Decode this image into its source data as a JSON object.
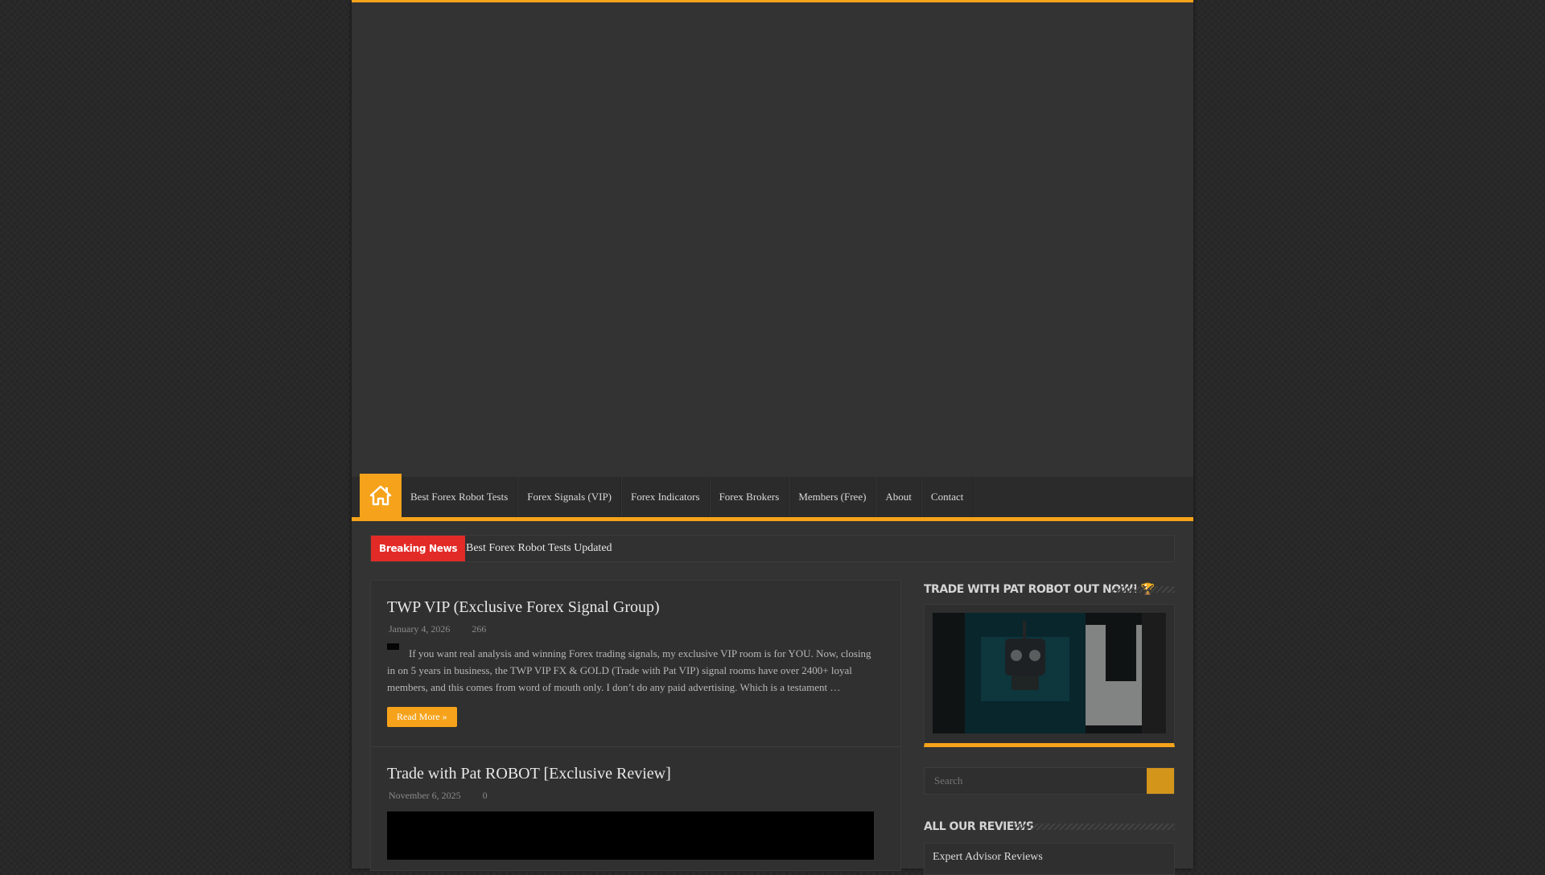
{
  "nav": {
    "items": [
      "Best Forex Robot Tests",
      "Forex Signals (VIP)",
      "Forex Indicators",
      "Forex Brokers",
      "Members (Free)",
      "About",
      "Contact"
    ]
  },
  "breaking": {
    "tag": "Breaking News",
    "headline": "Best Forex Robot Tests Updated"
  },
  "posts": [
    {
      "title": "TWP VIP (Exclusive Forex Signal Group)",
      "date": "January 4, 2026",
      "views": "266",
      "excerpt": "If you want real analysis and winning Forex trading signals, my exclusive VIP room is for YOU. Now, closing in on 5 years in business, the TWP VIP FX & GOLD (Trade with Pat VIP) signal rooms have over 2400+ loyal members, and this comes from word of mouth only. I don’t do any paid advertising. Which is a testament …",
      "read_more": "Read More »"
    },
    {
      "title": "Trade with Pat ROBOT [Exclusive Review]",
      "date": "November 6, 2025",
      "views": "0"
    }
  ],
  "sidebar": {
    "promo_title": "Trade with Pat ROBOT Out Now! 🏆",
    "search_placeholder": "Search",
    "reviews_title": "All Our Reviews",
    "reviews_first": "Expert Advisor Reviews"
  },
  "colors": {
    "accent": "#f6a31b",
    "breaking": "#e22b27",
    "background": "#333333"
  }
}
